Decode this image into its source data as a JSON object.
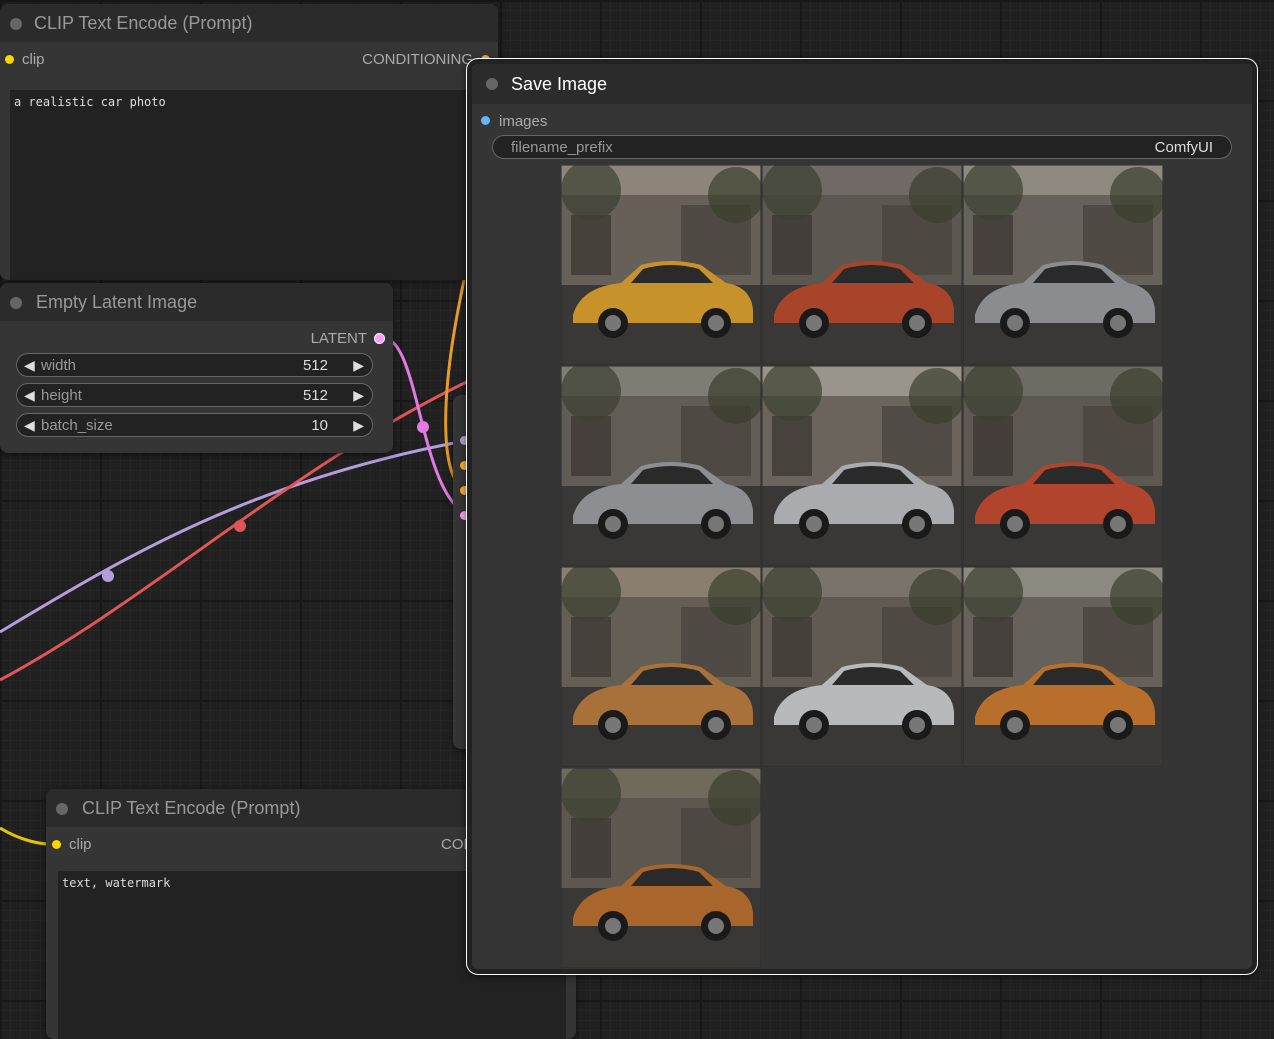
{
  "clip_top": {
    "title": "CLIP Text Encode (Prompt)",
    "input_label": "clip",
    "output_label": "CONDITIONING",
    "prompt_text": "a realistic car photo"
  },
  "latent": {
    "title": "Empty Latent Image",
    "output_label": "LATENT",
    "widgets": [
      {
        "label": "width",
        "value": "512"
      },
      {
        "label": "height",
        "value": "512"
      },
      {
        "label": "batch_size",
        "value": "10"
      }
    ]
  },
  "clip_bottom": {
    "title": "CLIP Text Encode (Prompt)",
    "input_label": "clip",
    "output_label": "CON",
    "prompt_text": "text, watermark"
  },
  "save": {
    "title": "Save Image",
    "input_label": "images",
    "prefix_label": "filename_prefix",
    "prefix_value": "ComfyUI",
    "image_count": 10
  },
  "colors": {
    "clip": "#ffd500",
    "conditioning": "#ffa931",
    "latent": "#ff9cf9",
    "image": "#64b5f6",
    "model": "#b39ddb",
    "vae": "#ff6e6e"
  },
  "icons": {
    "left_arrow": "◀",
    "right_arrow": "▶"
  }
}
